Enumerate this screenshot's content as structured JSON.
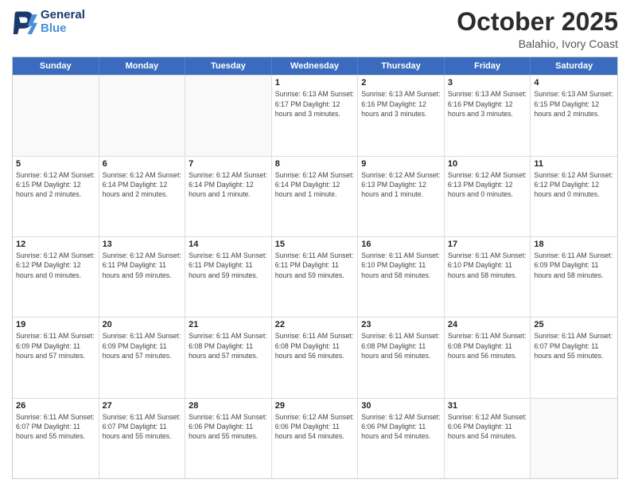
{
  "logo": {
    "line1": "General",
    "line2": "Blue"
  },
  "header": {
    "month": "October 2025",
    "location": "Balahio, Ivory Coast"
  },
  "weekdays": [
    "Sunday",
    "Monday",
    "Tuesday",
    "Wednesday",
    "Thursday",
    "Friday",
    "Saturday"
  ],
  "rows": [
    [
      {
        "day": "",
        "info": "",
        "empty": true
      },
      {
        "day": "",
        "info": "",
        "empty": true
      },
      {
        "day": "",
        "info": "",
        "empty": true
      },
      {
        "day": "1",
        "info": "Sunrise: 6:13 AM\nSunset: 6:17 PM\nDaylight: 12 hours\nand 3 minutes."
      },
      {
        "day": "2",
        "info": "Sunrise: 6:13 AM\nSunset: 6:16 PM\nDaylight: 12 hours\nand 3 minutes."
      },
      {
        "day": "3",
        "info": "Sunrise: 6:13 AM\nSunset: 6:16 PM\nDaylight: 12 hours\nand 3 minutes."
      },
      {
        "day": "4",
        "info": "Sunrise: 6:13 AM\nSunset: 6:15 PM\nDaylight: 12 hours\nand 2 minutes."
      }
    ],
    [
      {
        "day": "5",
        "info": "Sunrise: 6:12 AM\nSunset: 6:15 PM\nDaylight: 12 hours\nand 2 minutes."
      },
      {
        "day": "6",
        "info": "Sunrise: 6:12 AM\nSunset: 6:14 PM\nDaylight: 12 hours\nand 2 minutes."
      },
      {
        "day": "7",
        "info": "Sunrise: 6:12 AM\nSunset: 6:14 PM\nDaylight: 12 hours\nand 1 minute."
      },
      {
        "day": "8",
        "info": "Sunrise: 6:12 AM\nSunset: 6:14 PM\nDaylight: 12 hours\nand 1 minute."
      },
      {
        "day": "9",
        "info": "Sunrise: 6:12 AM\nSunset: 6:13 PM\nDaylight: 12 hours\nand 1 minute."
      },
      {
        "day": "10",
        "info": "Sunrise: 6:12 AM\nSunset: 6:13 PM\nDaylight: 12 hours\nand 0 minutes."
      },
      {
        "day": "11",
        "info": "Sunrise: 6:12 AM\nSunset: 6:12 PM\nDaylight: 12 hours\nand 0 minutes."
      }
    ],
    [
      {
        "day": "12",
        "info": "Sunrise: 6:12 AM\nSunset: 6:12 PM\nDaylight: 12 hours\nand 0 minutes."
      },
      {
        "day": "13",
        "info": "Sunrise: 6:12 AM\nSunset: 6:11 PM\nDaylight: 11 hours\nand 59 minutes."
      },
      {
        "day": "14",
        "info": "Sunrise: 6:11 AM\nSunset: 6:11 PM\nDaylight: 11 hours\nand 59 minutes."
      },
      {
        "day": "15",
        "info": "Sunrise: 6:11 AM\nSunset: 6:11 PM\nDaylight: 11 hours\nand 59 minutes."
      },
      {
        "day": "16",
        "info": "Sunrise: 6:11 AM\nSunset: 6:10 PM\nDaylight: 11 hours\nand 58 minutes."
      },
      {
        "day": "17",
        "info": "Sunrise: 6:11 AM\nSunset: 6:10 PM\nDaylight: 11 hours\nand 58 minutes."
      },
      {
        "day": "18",
        "info": "Sunrise: 6:11 AM\nSunset: 6:09 PM\nDaylight: 11 hours\nand 58 minutes."
      }
    ],
    [
      {
        "day": "19",
        "info": "Sunrise: 6:11 AM\nSunset: 6:09 PM\nDaylight: 11 hours\nand 57 minutes."
      },
      {
        "day": "20",
        "info": "Sunrise: 6:11 AM\nSunset: 6:09 PM\nDaylight: 11 hours\nand 57 minutes."
      },
      {
        "day": "21",
        "info": "Sunrise: 6:11 AM\nSunset: 6:08 PM\nDaylight: 11 hours\nand 57 minutes."
      },
      {
        "day": "22",
        "info": "Sunrise: 6:11 AM\nSunset: 6:08 PM\nDaylight: 11 hours\nand 56 minutes."
      },
      {
        "day": "23",
        "info": "Sunrise: 6:11 AM\nSunset: 6:08 PM\nDaylight: 11 hours\nand 56 minutes."
      },
      {
        "day": "24",
        "info": "Sunrise: 6:11 AM\nSunset: 6:08 PM\nDaylight: 11 hours\nand 56 minutes."
      },
      {
        "day": "25",
        "info": "Sunrise: 6:11 AM\nSunset: 6:07 PM\nDaylight: 11 hours\nand 55 minutes."
      }
    ],
    [
      {
        "day": "26",
        "info": "Sunrise: 6:11 AM\nSunset: 6:07 PM\nDaylight: 11 hours\nand 55 minutes."
      },
      {
        "day": "27",
        "info": "Sunrise: 6:11 AM\nSunset: 6:07 PM\nDaylight: 11 hours\nand 55 minutes."
      },
      {
        "day": "28",
        "info": "Sunrise: 6:11 AM\nSunset: 6:06 PM\nDaylight: 11 hours\nand 55 minutes."
      },
      {
        "day": "29",
        "info": "Sunrise: 6:12 AM\nSunset: 6:06 PM\nDaylight: 11 hours\nand 54 minutes."
      },
      {
        "day": "30",
        "info": "Sunrise: 6:12 AM\nSunset: 6:06 PM\nDaylight: 11 hours\nand 54 minutes."
      },
      {
        "day": "31",
        "info": "Sunrise: 6:12 AM\nSunset: 6:06 PM\nDaylight: 11 hours\nand 54 minutes."
      },
      {
        "day": "",
        "info": "",
        "empty": true
      }
    ]
  ]
}
